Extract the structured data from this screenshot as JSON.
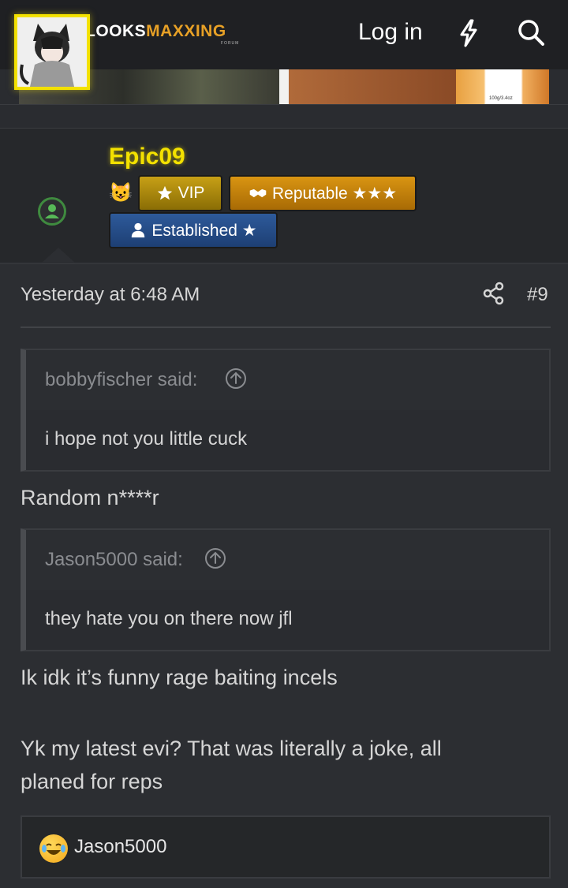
{
  "header": {
    "logo_main": "LOOKS",
    "logo_accent": "MAXXING",
    "logo_sub": "FORUM",
    "login_label": "Log in",
    "whats_new_icon": "bolt-icon",
    "search_icon": "search-icon",
    "menu_icon": "hamburger-icon"
  },
  "banner": {
    "product_tag": "100g/3.4oz"
  },
  "user": {
    "name": "Epic09",
    "name_color": "#f3e100",
    "status": "online",
    "badges": [
      {
        "icon": "star-icon",
        "label": "VIP"
      },
      {
        "icon": "handshake-icon",
        "label": "Reputable ★★★"
      },
      {
        "icon": "user-icon",
        "label": "Established ★"
      }
    ]
  },
  "post": {
    "date": "Yesterday at 6:48 AM",
    "number": "#9",
    "share_icon": "share-icon",
    "quotes": [
      {
        "author": "bobbyfischer said:",
        "text": "i hope not you little cuck"
      },
      {
        "author": "Jason5000 said:",
        "text": "they hate you on there now jfl"
      }
    ],
    "paragraphs": [
      "Random n****r",
      "Ik idk it’s funny rage baiting incels",
      "Yk my latest evi? That was literally a joke, all planed for reps"
    ],
    "reactions": {
      "emoji": "laughing-crying-emoji",
      "users": "Jason5000"
    }
  }
}
